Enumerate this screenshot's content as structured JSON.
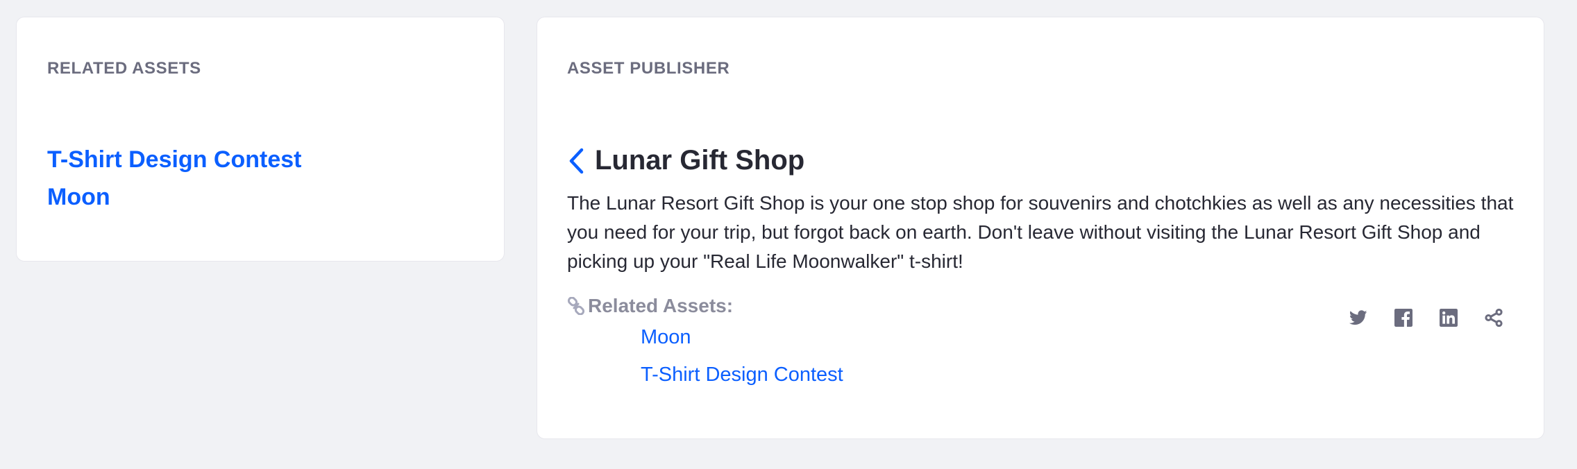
{
  "related_assets_widget": {
    "title": "RELATED ASSETS",
    "links": [
      "T-Shirt Design Contest",
      "Moon"
    ]
  },
  "asset_publisher_widget": {
    "title": "ASSET PUBLISHER",
    "asset": {
      "title": "Lunar Gift Shop",
      "summary": "The Lunar Resort Gift Shop is your one stop shop for souvenirs and chotchkies as well as any necessities that you need for your trip, but forgot back on earth. Don't leave without visiting the Lunar Resort Gift Shop and picking up your \"Real Life Moonwalker\" t-shirt!"
    },
    "related_assets": {
      "label": "Related Assets:",
      "links": [
        "Moon",
        "T-Shirt Design Contest"
      ]
    },
    "share_icons": [
      "twitter-icon",
      "facebook-icon",
      "linkedin-icon",
      "share-icon"
    ]
  },
  "colors": {
    "page_background": "#f1f2f5",
    "link": "#0b5fff",
    "heading": "#272833",
    "muted": "#6b6c7e",
    "icon": "#6b6c7e"
  }
}
